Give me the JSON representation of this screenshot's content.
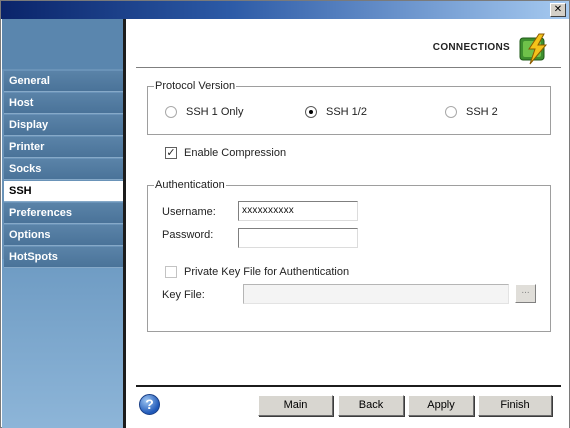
{
  "window": {
    "close_glyph": "✕"
  },
  "sidebar": {
    "items": [
      {
        "label": "General",
        "active": false
      },
      {
        "label": "Host",
        "active": false
      },
      {
        "label": "Display",
        "active": false
      },
      {
        "label": "Printer",
        "active": false
      },
      {
        "label": "Socks",
        "active": false
      },
      {
        "label": "SSH",
        "active": true
      },
      {
        "label": "Preferences",
        "active": false
      },
      {
        "label": "Options",
        "active": false
      },
      {
        "label": "HotSpots",
        "active": false
      }
    ]
  },
  "header": {
    "title": "CONNECTIONS",
    "icon": "connections-lightning-icon"
  },
  "protocol": {
    "legend": "Protocol Version",
    "options": [
      {
        "label": "SSH 1 Only",
        "selected": false
      },
      {
        "label": "SSH 1/2",
        "selected": true
      },
      {
        "label": "SSH 2",
        "selected": false
      }
    ]
  },
  "compression": {
    "label": "Enable Compression",
    "checked": true,
    "check_glyph": "✓"
  },
  "auth": {
    "legend": "Authentication",
    "username_label": "Username:",
    "username_value": "xxxxxxxxxx",
    "password_label": "Password:",
    "password_value": "",
    "private_key_label": "Private Key File for Authentication",
    "private_key_checked": false,
    "key_file_label": "Key File:",
    "key_file_value": "",
    "browse_label": "..."
  },
  "footer": {
    "help_glyph": "?",
    "buttons": {
      "main": "Main",
      "back": "Back",
      "apply": "Apply",
      "finish": "Finish"
    }
  },
  "colors": {
    "sidebar_bg": "#6a93b8",
    "nav_item_bg": "#4a7399",
    "active_bg": "#ffffff",
    "title_gradient_start": "#0a246a",
    "title_gradient_end": "#a6caf0"
  }
}
